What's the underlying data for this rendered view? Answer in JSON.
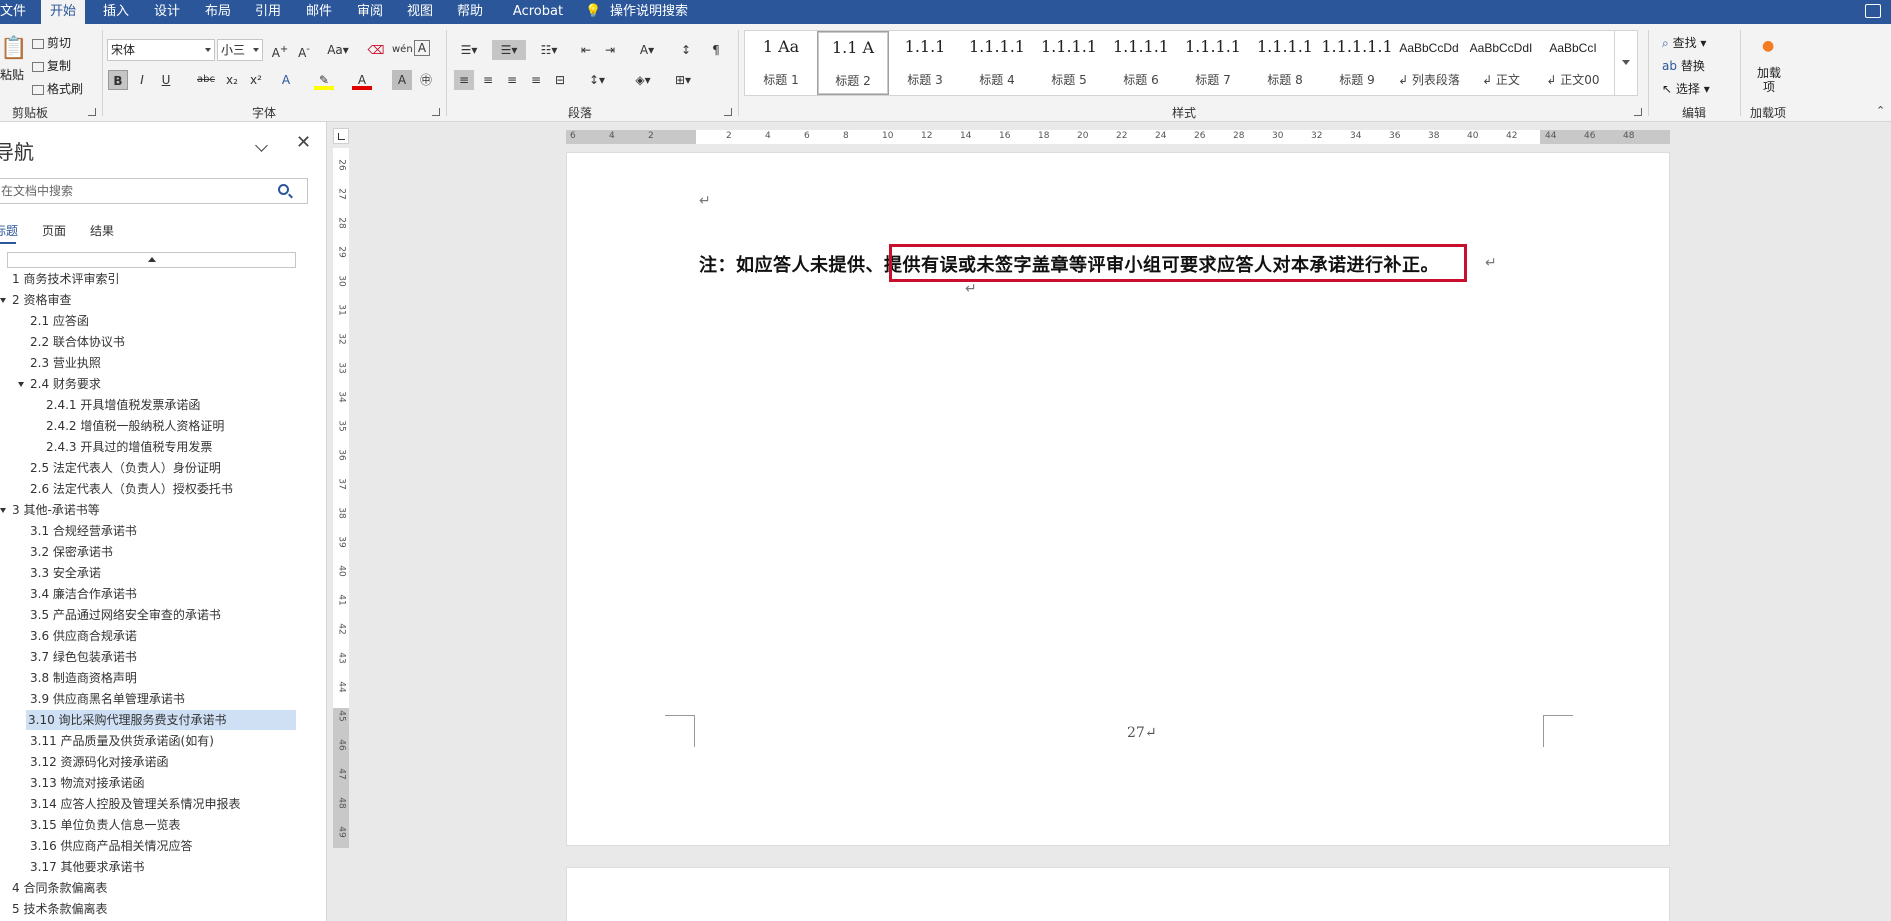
{
  "menu": {
    "tabs": [
      "文件",
      "开始",
      "插入",
      "设计",
      "布局",
      "引用",
      "邮件",
      "审阅",
      "视图",
      "帮助",
      "Acrobat"
    ],
    "active": "开始",
    "tell_me": "操作说明搜索"
  },
  "ribbon": {
    "clipboard": {
      "paste": "粘贴",
      "cut": "剪切",
      "copy": "复制",
      "format_painter": "格式刷",
      "group": "剪贴板"
    },
    "font": {
      "name": "宋体",
      "size": "小三",
      "group": "字体",
      "buttons": [
        "B",
        "I",
        "U",
        "abc",
        "x₂",
        "x²"
      ]
    },
    "paragraph": {
      "group": "段落"
    },
    "styles": {
      "group": "样式",
      "items": [
        {
          "preview": "1  Aa",
          "name": "标题 1"
        },
        {
          "preview": "1.1  A",
          "name": "标题 2"
        },
        {
          "preview": "1.1.1",
          "name": "标题 3"
        },
        {
          "preview": "1.1.1.1",
          "name": "标题 4"
        },
        {
          "preview": "1.1.1.1",
          "name": "标题 5"
        },
        {
          "preview": "1.1.1.1",
          "name": "标题 6"
        },
        {
          "preview": "1.1.1.1",
          "name": "标题 7"
        },
        {
          "preview": "1.1.1.1",
          "name": "标题 8"
        },
        {
          "preview": "1.1.1.1.1",
          "name": "标题 9"
        },
        {
          "preview": "AaBbCcDd",
          "name": "↲ 列表段落"
        },
        {
          "preview": "AaBbCcDdI",
          "name": "↲ 正文"
        },
        {
          "preview": "AaBbCcI",
          "name": "↲ 正文00"
        }
      ],
      "selected_index": 1
    },
    "editing": {
      "find": "查找",
      "replace": "替换",
      "select": "选择",
      "group": "编辑"
    },
    "addins": {
      "label": "加载项",
      "group": "加载项"
    }
  },
  "nav": {
    "title": "导航",
    "search_placeholder": "在文档中搜索",
    "tabs": [
      "标题",
      "页面",
      "结果"
    ],
    "items": [
      {
        "text": "1 商务技术评审索引",
        "level": 0
      },
      {
        "text": "2 资格审查",
        "level": 0,
        "expanded": true
      },
      {
        "text": "2.1 应答函",
        "level": 1
      },
      {
        "text": "2.2 联合体协议书",
        "level": 1
      },
      {
        "text": "2.3 营业执照",
        "level": 1
      },
      {
        "text": "2.4 财务要求",
        "level": 1,
        "expanded": true
      },
      {
        "text": "2.4.1 开具增值税发票承诺函",
        "level": 2
      },
      {
        "text": "2.4.2 增值税一般纳税人资格证明",
        "level": 2
      },
      {
        "text": "2.4.3 开具过的增值税专用发票",
        "level": 2
      },
      {
        "text": "2.5 法定代表人（负责人）身份证明",
        "level": 1
      },
      {
        "text": "2.6 法定代表人（负责人）授权委托书",
        "level": 1
      },
      {
        "text": "3 其他-承诺书等",
        "level": 0,
        "expanded": true
      },
      {
        "text": "3.1 合规经营承诺书",
        "level": 1
      },
      {
        "text": "3.2 保密承诺书",
        "level": 1
      },
      {
        "text": "3.3 安全承诺",
        "level": 1
      },
      {
        "text": "3.4 廉洁合作承诺书",
        "level": 1
      },
      {
        "text": "3.5 产品通过网络安全审查的承诺书",
        "level": 1
      },
      {
        "text": "3.6 供应商合规承诺",
        "level": 1
      },
      {
        "text": "3.7 绿色包装承诺书",
        "level": 1
      },
      {
        "text": "3.8 制造商资格声明",
        "level": 1
      },
      {
        "text": "3.9 供应商黑名单管理承诺书",
        "level": 1
      },
      {
        "text": "3.10 询比采购代理服务费支付承诺书",
        "level": 1,
        "selected": true
      },
      {
        "text": "3.11 产品质量及供货承诺函(如有)",
        "level": 1
      },
      {
        "text": "3.12 资源码化对接承诺函",
        "level": 1
      },
      {
        "text": "3.13 物流对接承诺函",
        "level": 1
      },
      {
        "text": "3.14 应答人控股及管理关系情况申报表",
        "level": 1
      },
      {
        "text": "3.15 单位负责人信息一览表",
        "level": 1
      },
      {
        "text": "3.16 供应商产品相关情况应答",
        "level": 1
      },
      {
        "text": "3.17 其他要求承诺书",
        "level": 1
      },
      {
        "text": "4 合同条款偏离表",
        "level": 0
      },
      {
        "text": "5 技术条款偏离表",
        "level": 0
      }
    ]
  },
  "ruler": {
    "h_ticks": [
      "6",
      "4",
      "2",
      "",
      "2",
      "4",
      "6",
      "8",
      "10",
      "12",
      "14",
      "16",
      "18",
      "20",
      "22",
      "24",
      "26",
      "28",
      "30",
      "32",
      "34",
      "36",
      "38",
      "40",
      "42",
      "44",
      "46",
      "48"
    ],
    "v_ticks": [
      "26",
      "27",
      "28",
      "29",
      "30",
      "31",
      "32",
      "33",
      "34",
      "35",
      "36",
      "37",
      "38",
      "39",
      "40",
      "41",
      "42",
      "43",
      "44",
      "45",
      "46",
      "47",
      "48",
      "49"
    ]
  },
  "document": {
    "note_prefix": "注：如应答人未提供、",
    "note_highlight": "提供有误或未签字盖章等评审小组可要求应答人对本承诺进行补正。",
    "paragraph_mark": "↵",
    "page_number": "27↵",
    "highlight_color": "#c8102e"
  },
  "colors": {
    "brand": "#2b579a",
    "nav_selected": "#cfe0f5"
  }
}
